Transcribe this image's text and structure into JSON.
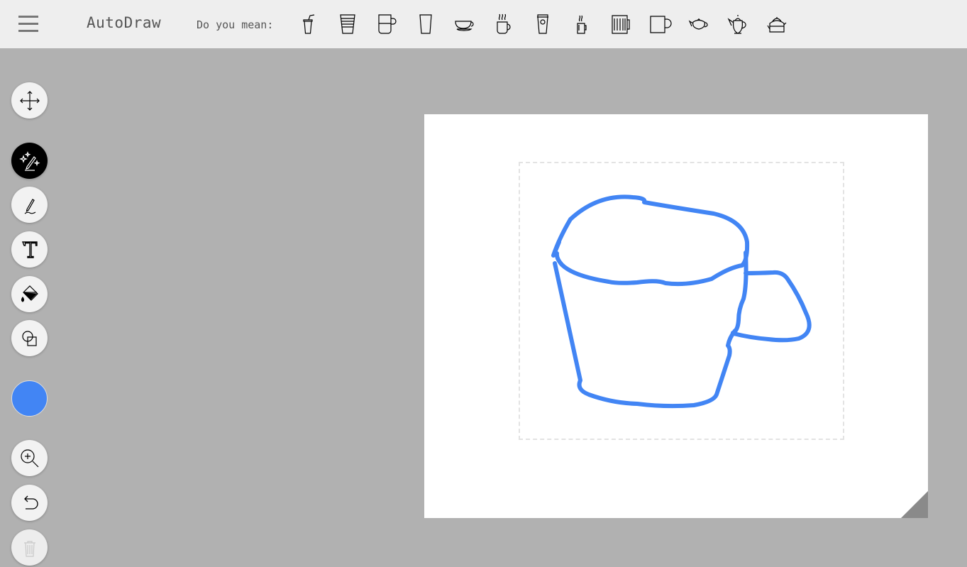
{
  "header": {
    "brand": "AutoDraw",
    "prompt": "Do you mean:",
    "suggestions": [
      "drink-cup-with-straw-icon",
      "paper-cup-icon",
      "measuring-mug-icon",
      "tall-glass-icon",
      "teacup-saucer-icon",
      "hot-mug-icon",
      "coffee-to-go-cup-icon",
      "steaming-travel-cup-icon",
      "beer-mug-icon",
      "plain-mug-icon",
      "teapot-icon",
      "ornate-teapot-icon",
      "kettle-icon"
    ]
  },
  "toolbar": {
    "tools": [
      "move-tool",
      "autodraw-tool",
      "draw-tool",
      "type-tool",
      "fill-tool",
      "shape-tool",
      "color-picker",
      "zoom-tool",
      "undo-button",
      "delete-button"
    ],
    "color": "#4285f4"
  },
  "canvas": {
    "background": "#ffffff",
    "stroke_color": "#4285f4"
  }
}
